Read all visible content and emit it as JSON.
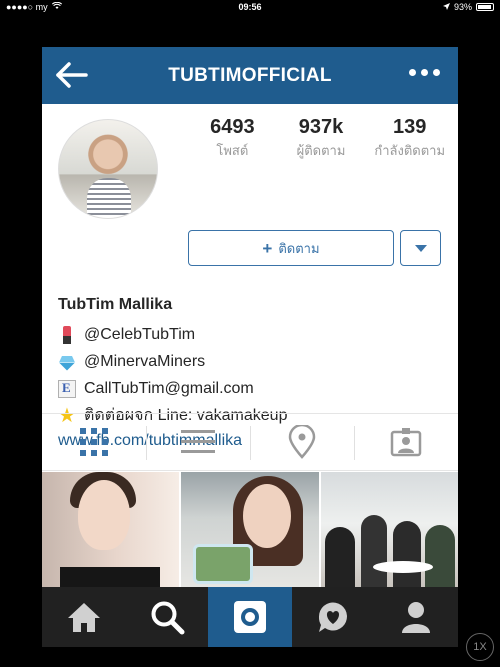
{
  "status_bar": {
    "carrier": "●●●●○ my",
    "time": "09:56",
    "battery": "93%"
  },
  "nav": {
    "title": "TUBTIMOFFICIAL",
    "back_icon": "arrow-left-icon",
    "more_icon": "more-horizontal-icon"
  },
  "profile": {
    "stats": [
      {
        "value": "6493",
        "label": "โพสต์"
      },
      {
        "value": "937k",
        "label": "ผู้ติดตาม"
      },
      {
        "value": "139",
        "label": "กำลังติดตาม"
      }
    ],
    "follow_label": "ติดตาม",
    "name": "TubTim Mallika",
    "bio": [
      {
        "icon": "lipstick-icon",
        "text": "@CelebTubTim"
      },
      {
        "icon": "gem-icon",
        "text": "@MinervaMiners"
      },
      {
        "icon": "email-icon",
        "text": "CallTubTim@gmail.com"
      },
      {
        "icon": "star-icon",
        "text": "ติดต่อผจก Line: vakamakeup"
      }
    ],
    "website": "www.fb.com/tubtimmallika"
  },
  "tabs": [
    "grid-icon",
    "list-icon",
    "location-pin-icon",
    "tagged-person-icon"
  ],
  "bottom_tabs": [
    "home-icon",
    "search-icon",
    "camera-icon",
    "activity-heart-icon",
    "profile-icon"
  ],
  "zoom_label": "1X",
  "colors": {
    "nav_bg": "#1f5c8e",
    "accent": "#3a73a8",
    "tabbar_bg": "#212121"
  }
}
